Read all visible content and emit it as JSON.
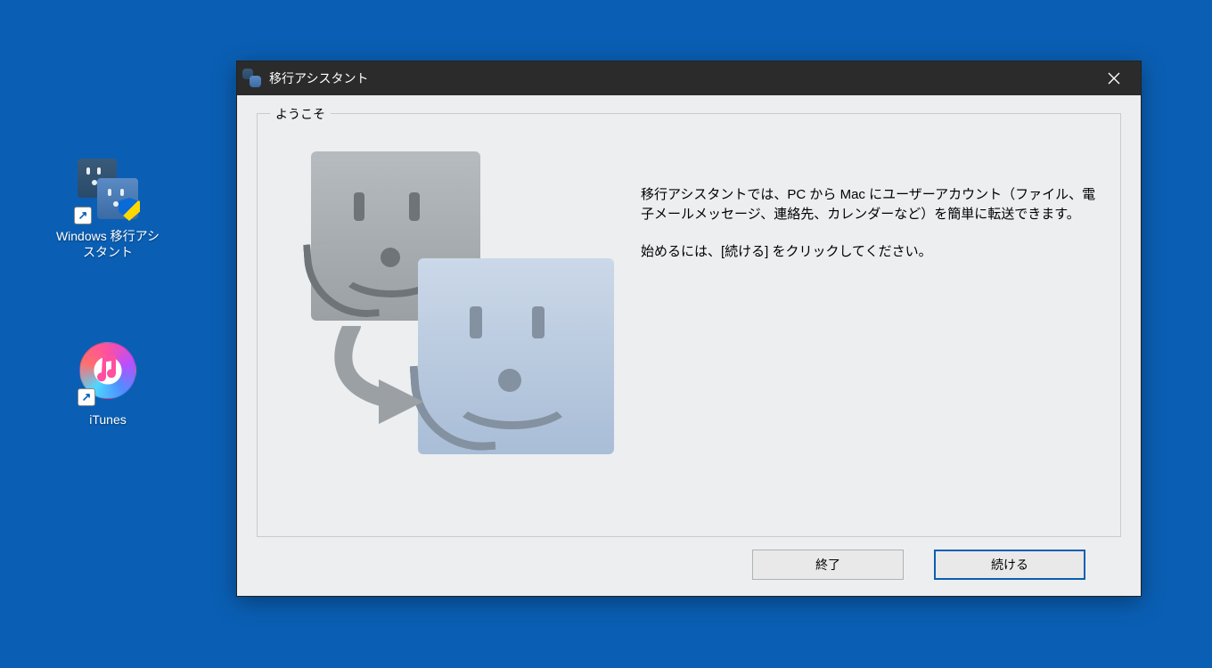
{
  "desktop": {
    "icons": [
      {
        "name": "migration-assistant",
        "label": "Windows 移行アシスタント"
      },
      {
        "name": "itunes",
        "label": "iTunes"
      }
    ]
  },
  "dialog": {
    "title": "移行アシスタント",
    "groupbox_legend": "ようこそ",
    "description_paragraph1": "移行アシスタントでは、PC から Mac にユーザーアカウント（ファイル、電子メールメッセージ、連絡先、カレンダーなど）を簡単に転送できます。",
    "description_paragraph2": "始めるには、[続ける] をクリックしてください。",
    "buttons": {
      "quit": "終了",
      "continue": "続ける"
    }
  }
}
